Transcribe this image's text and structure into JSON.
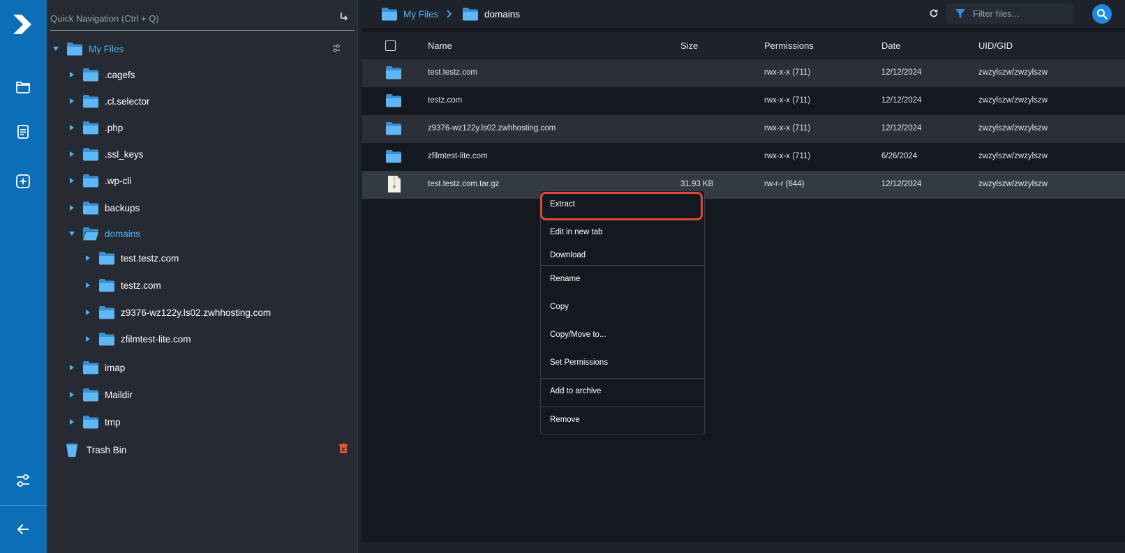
{
  "colors": {
    "rail": "#0c6fb5",
    "accent": "#4fb3f6",
    "folder": "#5fb8f5",
    "highlight": "#e2473b",
    "trash_delete": "#e0562a"
  },
  "rail": {
    "icons": [
      "logo-icon",
      "folder-icon",
      "document-icon",
      "add-icon",
      "settings-icon",
      "back-arrow-icon"
    ]
  },
  "quick_nav": {
    "placeholder": "Quick Navigation (Ctrl + Q)"
  },
  "tree": {
    "root": "My Files",
    "items": [
      {
        "label": ".cagefs"
      },
      {
        "label": ".cl.selector"
      },
      {
        "label": ".php"
      },
      {
        "label": ".ssl_keys"
      },
      {
        "label": ".wp-cli"
      },
      {
        "label": "backups"
      },
      {
        "label": "domains"
      },
      {
        "label": "test.testz.com"
      },
      {
        "label": "testz.com"
      },
      {
        "label": "z9376-wz122y.ls02.zwhhosting.com"
      },
      {
        "label": "zfilmtest-lite.com"
      },
      {
        "label": "imap"
      },
      {
        "label": "Maildir"
      },
      {
        "label": "tmp"
      }
    ],
    "trash": "Trash Bin"
  },
  "breadcrumb": {
    "root": "My Files",
    "current": "domains"
  },
  "filter": {
    "placeholder": "Filter files..."
  },
  "table": {
    "headers": {
      "name": "Name",
      "size": "Size",
      "permissions": "Permissions",
      "date": "Date",
      "uid": "UID/GID"
    },
    "rows": [
      {
        "name": "test.testz.com",
        "size": "",
        "permissions": "rwx-x-x (711)",
        "date": "12/12/2024",
        "uid": "zwzylszw/zwzylszw",
        "type": "folder"
      },
      {
        "name": "testz.com",
        "size": "",
        "permissions": "rwx-x-x (711)",
        "date": "12/12/2024",
        "uid": "zwzylszw/zwzylszw",
        "type": "folder"
      },
      {
        "name": "z9376-wz122y.ls02.zwhhosting.com",
        "size": "",
        "permissions": "rwx-x-x (711)",
        "date": "12/12/2024",
        "uid": "zwzylszw/zwzylszw",
        "type": "folder"
      },
      {
        "name": "zfilmtest-lite.com",
        "size": "",
        "permissions": "rwx-x-x (711)",
        "date": "6/26/2024",
        "uid": "zwzylszw/zwzylszw",
        "type": "folder"
      },
      {
        "name": "test.testz.com.tar.gz",
        "size": "31.93 KB",
        "permissions": "rw-r-r (644)",
        "date": "12/12/2024",
        "uid": "zwzylszw/zwzylszw",
        "type": "archive"
      }
    ]
  },
  "context_menu": {
    "items": [
      "Extract",
      "Edit in new tab",
      "Download",
      "Rename",
      "Copy",
      "Copy/Move to...",
      "Set Permissions",
      "Add to archive",
      "Remove"
    ]
  }
}
